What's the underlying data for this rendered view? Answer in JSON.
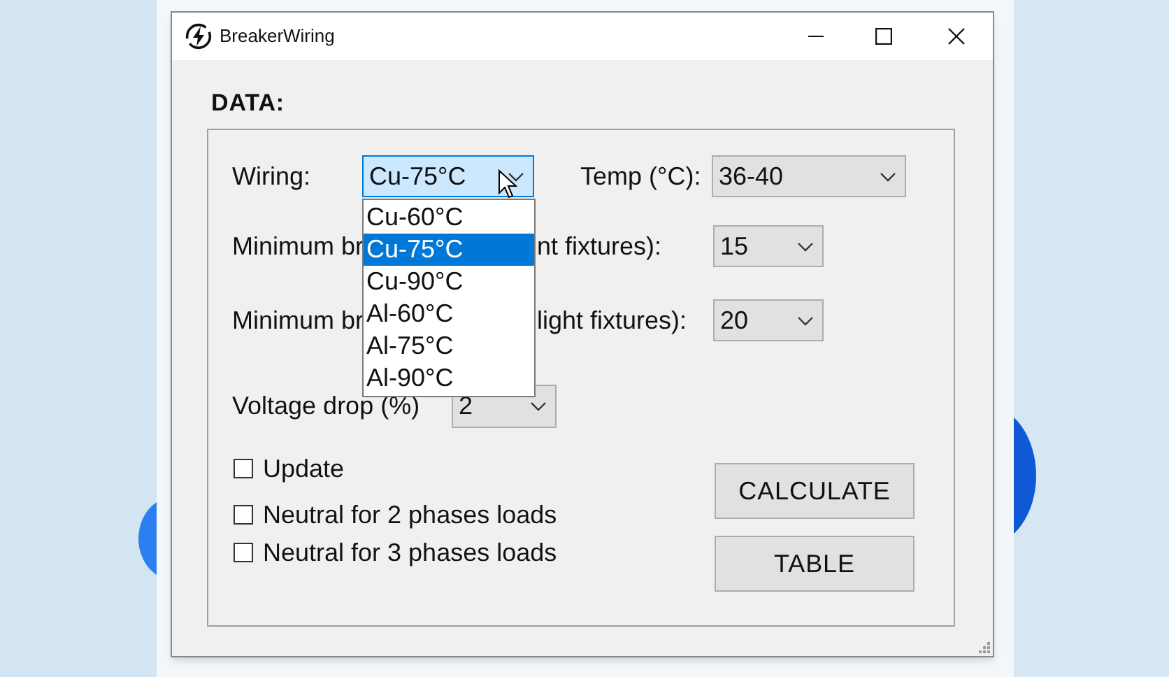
{
  "window": {
    "title": "BreakerWiring"
  },
  "group": {
    "title": "DATA:"
  },
  "wiring": {
    "label": "Wiring:",
    "value": "Cu-75°C",
    "open": true,
    "options": [
      {
        "label": "Cu-60°C",
        "selected": false
      },
      {
        "label": "Cu-75°C",
        "selected": true
      },
      {
        "label": "Cu-90°C",
        "selected": false
      },
      {
        "label": "Al-60°C",
        "selected": false
      },
      {
        "label": "Al-75°C",
        "selected": false
      },
      {
        "label": "Al-90°C",
        "selected": false
      }
    ]
  },
  "temp": {
    "label": "Temp (°C):",
    "value": "36-40"
  },
  "minimum_rows": [
    {
      "label_start": "Minimum br",
      "label_end": "nt fixtures):",
      "value": "15"
    },
    {
      "label_start": "Minimum br",
      "label_end": "light fixtures):",
      "value": "20"
    }
  ],
  "voltage_drop": {
    "label": "Voltage drop (%)",
    "value": "2"
  },
  "checkboxes": [
    {
      "label": "Update",
      "checked": false
    },
    {
      "label": "Neutral for 2 phases loads",
      "checked": false
    },
    {
      "label": "Neutral for 3 phases loads",
      "checked": false
    }
  ],
  "buttons": [
    "CALCULATE",
    "TABLE"
  ]
}
